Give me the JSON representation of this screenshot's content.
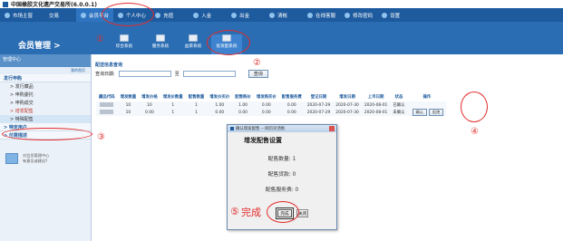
{
  "title": "中国橡胶文化遗产交易所(6.0.0.1)",
  "nav": {
    "items": [
      {
        "label": "市场主窗"
      },
      {
        "label": "交易"
      },
      {
        "label": "会员平台"
      },
      {
        "label": "个人中心"
      },
      {
        "label": "充值"
      },
      {
        "label": "入金"
      },
      {
        "label": "出金"
      },
      {
        "label": "清帐"
      },
      {
        "label": "在线客服"
      },
      {
        "label": "修改密码"
      },
      {
        "label": "设置"
      }
    ]
  },
  "subbar": {
    "member_mgmt": "会员管理  >",
    "modules": [
      {
        "label": "综合系统"
      },
      {
        "label": "服务系统"
      },
      {
        "label": "益禀系统"
      },
      {
        "label": "投资配系统"
      }
    ]
  },
  "sidebar": {
    "header": "管理中心",
    "sub": "我的首页",
    "groups": [
      {
        "label": "发行申购",
        "items": [
          {
            "label": "> 发行藏品",
            "style": "normal"
          },
          {
            "label": "> 申购委托",
            "style": "normal"
          },
          {
            "label": "> 申购成交",
            "style": "normal"
          },
          {
            "label": "> 增发配售",
            "style": "red"
          },
          {
            "label": "> 特殊配售",
            "style": "selected"
          }
        ]
      },
      {
        "label": "> 特定用户",
        "items": []
      },
      {
        "label": "> 付费描述",
        "items": []
      }
    ],
    "widget_text": [
      "对会员管理中心",
      "有意见或建议?"
    ]
  },
  "main": {
    "section_title": "配送信息查询",
    "filter": {
      "label": "查询日期:",
      "to_label": "至",
      "query_button": "查询"
    },
    "columns": [
      "藏品代码",
      "增发数量",
      "增发价格",
      "增发价数量",
      "配售数量",
      "增发价买价",
      "配售购价",
      "增发购买价",
      "配售服务费",
      "登记日期",
      "增发日期",
      "上市日期",
      "状态",
      "操作"
    ],
    "rows": [
      {
        "cells": [
          "",
          "10",
          "10",
          "1",
          "1",
          "1.00",
          "1.00",
          "0.00",
          "0.00",
          "2020-07-29",
          "2020-07-30",
          "2020-08-01",
          "已确认",
          ""
        ],
        "actions": []
      },
      {
        "cells": [
          "",
          "10",
          "0.00",
          "1",
          "1",
          "0.00",
          "0.00",
          "0.00",
          "0.00",
          "2020-07-29",
          "2020-07-30",
          "2020-08-01",
          "未确认",
          ""
        ],
        "actions": [
          "确认",
          "拒绝"
        ]
      }
    ]
  },
  "dialog": {
    "window_title": "确认增发配售 -- 网页对话框",
    "heading": "增发配售设置",
    "lines": [
      "配售数量: 1",
      "配售货款: 0",
      "配售服务费: 0"
    ],
    "ok_button": "完成",
    "close_button": "关闭"
  },
  "annotations": {
    "n1": "①",
    "n2": "②",
    "n3": "③",
    "n4": "④",
    "n5_num": "⑤",
    "n5_text": "完成"
  },
  "colors": {
    "nav_bg": "#1d5a9e",
    "subbar_bg": "#2a6db3",
    "annotation": "#e32b2b",
    "sidebar_bg": "#eaf1f9"
  }
}
